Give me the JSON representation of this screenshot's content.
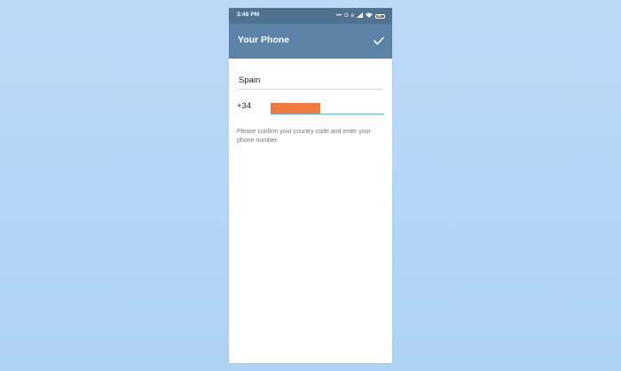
{
  "status_bar": {
    "time": "3:48 PM",
    "icons": [
      "dots-icon",
      "sync-icon",
      "bluetooth-icon",
      "signal-icon",
      "wifi-icon",
      "battery-icon"
    ]
  },
  "header": {
    "title": "Your Phone",
    "done_icon": "checkmark-icon"
  },
  "form": {
    "country": "Spain",
    "country_code": "+34",
    "phone_number": "",
    "hint": "Please confirm your country code and enter your phone number."
  },
  "colors": {
    "status_bar": "#4f7291",
    "app_bar": "#5b83a8",
    "input_underline_active": "#62a9dc",
    "redaction": "#f07a3d",
    "background": "#b5d6f6"
  }
}
